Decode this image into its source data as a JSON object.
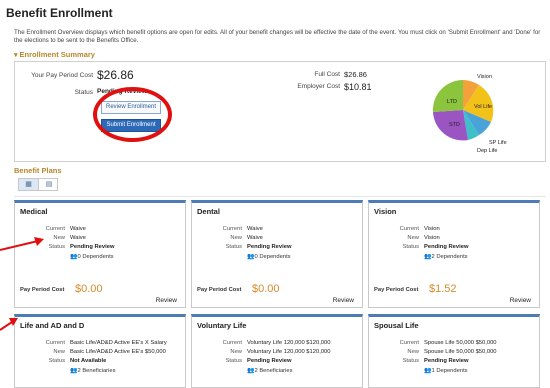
{
  "page": {
    "title": "Benefit Enrollment",
    "intro": "The Enrollment Overview displays which benefit options are open for edits. All of your benefit changes will be effective the date of the event. You must click on 'Submit Enrollment' and 'Done' for the elections to be sent to the Benefits Office."
  },
  "summary": {
    "header": "Enrollment Summary",
    "pay_period_cost_label": "Your Pay Period Cost",
    "pay_period_cost": "$26.86",
    "status_label": "Status",
    "status": "Pending Review",
    "review_button": "Review Enrollment",
    "submit_button": "Submit Enrollment",
    "full_cost_label": "Full Cost",
    "full_cost": "$26.86",
    "employer_cost_label": "Employer Cost",
    "employer_cost": "$10.81",
    "pie_labels": {
      "vision": "Vision",
      "ltd": "LTD",
      "vol_life": "Vol Life",
      "std": "STD",
      "sp_life": "SP Life",
      "dep_life": "Dep Life"
    }
  },
  "plans": {
    "header": "Benefit Plans",
    "view_icons": [
      "tile-view-icon",
      "list-view-icon"
    ],
    "labels": {
      "current": "Current",
      "new": "New",
      "status": "Status",
      "pay_period_cost": "Pay Period Cost",
      "review": "Review"
    },
    "medical": {
      "title": "Medical",
      "current": "Waive",
      "new": "Waive",
      "status": "Pending Review",
      "dependents": "0 Dependents",
      "cost": "$0.00"
    },
    "dental": {
      "title": "Dental",
      "current": "Waive",
      "new": "Waive",
      "status": "Pending Review",
      "dependents": "0 Dependents",
      "cost": "$0.00"
    },
    "vision": {
      "title": "Vision",
      "current": "Vision",
      "new": "Vision",
      "status": "Pending Review",
      "dependents": "2 Dependents",
      "cost": "$1.52"
    },
    "life_ad_d": {
      "title": "Life and AD and D",
      "current": "Basic Life/AD&D Active EE's  X Salary",
      "new": "Basic Life/AD&D Active EE's $50,000",
      "status": "Not Available",
      "beneficiaries": "2 Beneficiaries"
    },
    "voluntary_life": {
      "title": "Voluntary Life",
      "current": "Voluntary Life 120,000 $120,000",
      "new": "Voluntary Life 120,000 $120,000",
      "status": "Pending Review",
      "beneficiaries": "2 Beneficiaries"
    },
    "spousal_life": {
      "title": "Spousal Life",
      "current": "Spouse Life 50,000 $50,000",
      "new": "Spouse Life 50,000 $50,000",
      "status": "Pending Review",
      "dependents": "1 Dependents"
    }
  },
  "colors": {
    "accent": "#d58a2c",
    "card_top": "#4c7bb5",
    "annotation_red": "#e01010",
    "pie_vision": "#f3a23b",
    "pie_vol_life": "#f2c21b",
    "pie_ltd": "#8cc43d",
    "pie_std": "#9b55c2",
    "pie_sp_life": "#4aa3d8",
    "pie_dep_life": "#3fc0c9"
  }
}
